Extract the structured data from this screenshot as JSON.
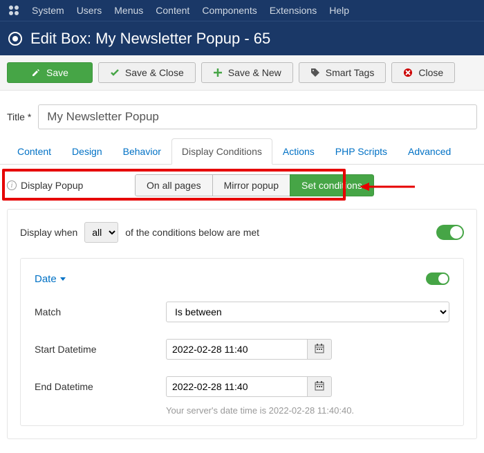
{
  "adminMenu": [
    "System",
    "Users",
    "Menus",
    "Content",
    "Components",
    "Extensions",
    "Help"
  ],
  "pageTitle": "Edit Box: My Newsletter Popup - 65",
  "toolbar": {
    "save": "Save",
    "saveClose": "Save & Close",
    "saveNew": "Save & New",
    "smartTags": "Smart Tags",
    "close": "Close"
  },
  "titleField": {
    "label": "Title *",
    "value": "My Newsletter Popup"
  },
  "tabs": [
    "Content",
    "Design",
    "Behavior",
    "Display Conditions",
    "Actions",
    "PHP Scripts",
    "Advanced"
  ],
  "activeTab": 3,
  "displayPopup": {
    "label": "Display Popup",
    "options": [
      "On all pages",
      "Mirror popup",
      "Set conditions"
    ],
    "active": 2
  },
  "conditions": {
    "textBefore": "Display when",
    "selector": "all",
    "textAfter": "of the conditions below are met",
    "mainToggle": true,
    "dateLabel": "Date",
    "dateToggle": true,
    "matchLabel": "Match",
    "matchValue": "Is between",
    "startLabel": "Start Datetime",
    "startValue": "2022-02-28 11:40",
    "endLabel": "End Datetime",
    "endValue": "2022-02-28 11:40",
    "hint": "Your server's date time is 2022-02-28 11:40:40."
  }
}
